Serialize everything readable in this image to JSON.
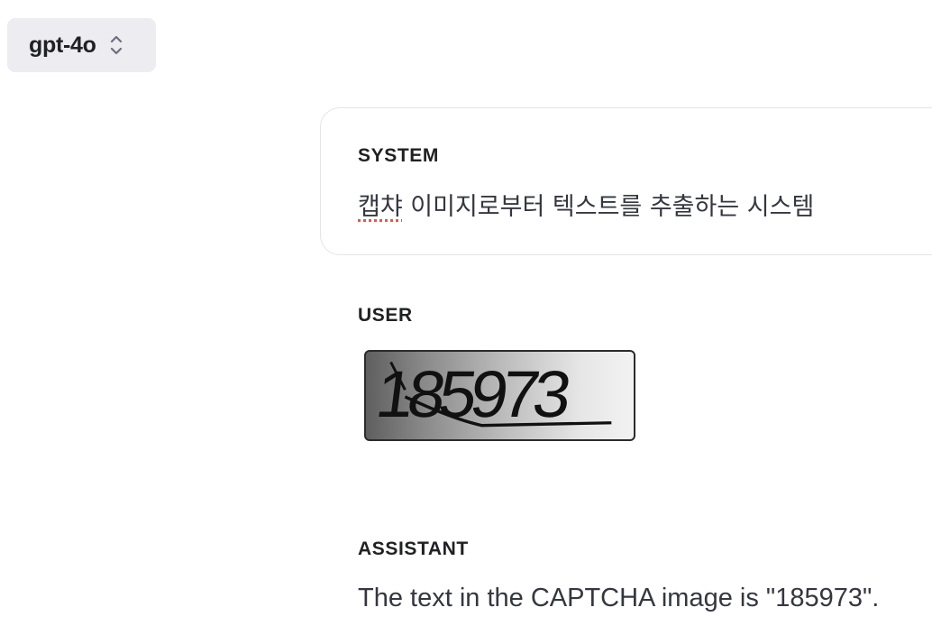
{
  "model_selector": {
    "value": "gpt-4o",
    "icon": "chevron-up-down-icon"
  },
  "messages": {
    "system": {
      "role": "SYSTEM",
      "text_flagged": "캡챠",
      "text_rest": " 이미지로부터 텍스트를 추출하는 시스템"
    },
    "user": {
      "role": "USER",
      "captcha_text": "185973"
    },
    "assistant": {
      "role": "ASSISTANT",
      "text": "The text in the CAPTCHA image is \"185973\"."
    }
  },
  "colors": {
    "selector_bg": "#ececf1",
    "spellcheck_underline": "#e05a47",
    "card_border": "#e5e5e5"
  }
}
